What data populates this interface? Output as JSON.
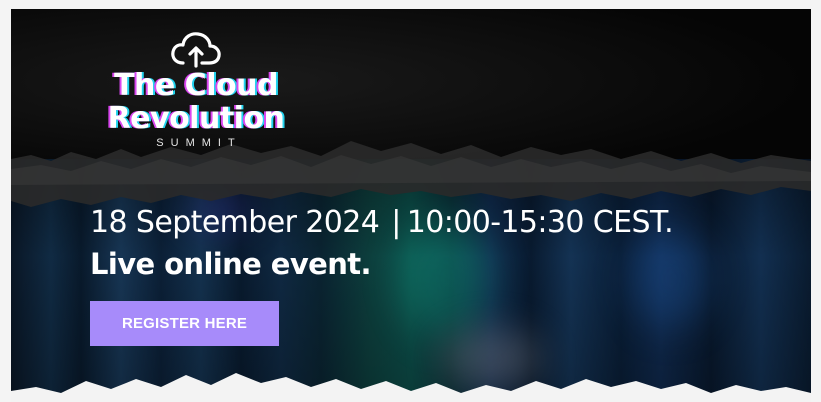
{
  "banner": {
    "logo": {
      "title_line1": "The Cloud",
      "title_line2": "Revolution",
      "subtitle": "SUMMIT",
      "icon": "cloud-upload-icon"
    },
    "date": "18 September 2024",
    "separator": "|",
    "time": "10:00-15:30 CEST.",
    "event_text": "Live online event.",
    "cta_label": "REGISTER HERE",
    "colors": {
      "button": "#a78bfa",
      "text": "#ffffff",
      "glitch_magenta": "#d946ef",
      "glitch_cyan": "#22d3ee"
    }
  }
}
